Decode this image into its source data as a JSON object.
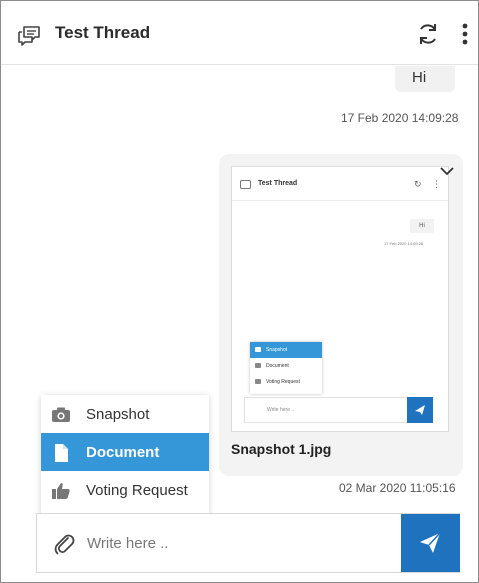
{
  "header": {
    "title": "Test Thread",
    "icons": {
      "thread": "chat-bubbles-icon",
      "refresh": "refresh-icon",
      "more": "more-vertical-icon"
    }
  },
  "messages": [
    {
      "type": "text",
      "text": "Hi",
      "timestamp": "17 Feb 2020 14:09:28"
    },
    {
      "type": "image",
      "caption": "Snapshot 1.jpg",
      "timestamp": "02 Mar 2020 11:05:16",
      "thumbnail": {
        "title": "Test Thread",
        "hi_text": "Hi",
        "timestamp": "17 Feb 2020 14:09:28",
        "menu": [
          "Snapshot",
          "Document",
          "Voting Request"
        ],
        "input_placeholder": "Write here .."
      }
    }
  ],
  "attach_menu": {
    "items": [
      {
        "label": "Snapshot",
        "icon": "camera-icon",
        "active": false
      },
      {
        "label": "Document",
        "icon": "document-icon",
        "active": true
      },
      {
        "label": "Voting Request",
        "icon": "thumbs-up-icon",
        "active": false
      }
    ]
  },
  "composer": {
    "placeholder": "Write here ..",
    "value": "",
    "icons": {
      "attach": "paperclip-icon",
      "send": "send-icon"
    }
  },
  "colors": {
    "accent": "#3596d8",
    "send_button": "#1f72bd",
    "bubble": "#f1f1f1"
  }
}
